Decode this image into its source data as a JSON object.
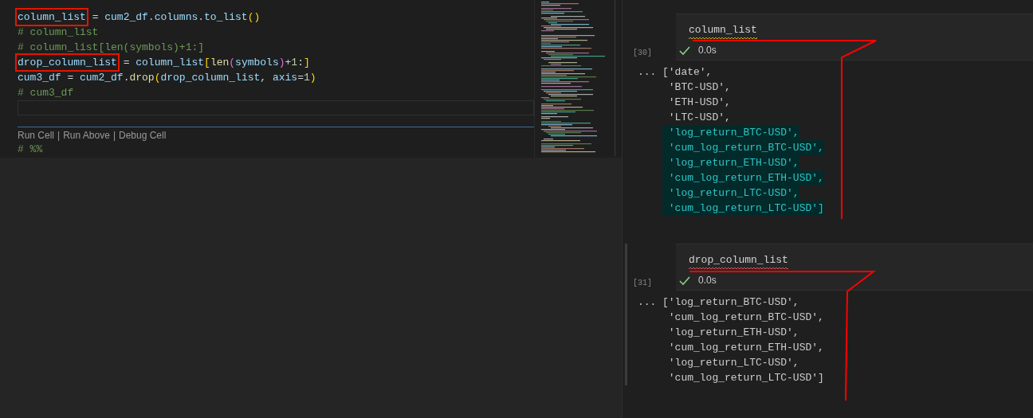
{
  "editor": {
    "lines": [
      [
        {
          "text": "column_list",
          "kind": "var",
          "boxed": true
        },
        {
          "text": " = ",
          "kind": "plain",
          "boxed": false
        },
        {
          "text": "cum2_df.columns.to_list",
          "kind": "var",
          "boxed": false
        },
        {
          "text": "()",
          "kind": "paren",
          "boxed": false
        }
      ],
      [
        {
          "text": "# column_list",
          "kind": "comment",
          "boxed": false
        }
      ],
      [
        {
          "text": "# column_list[len(symbols)+1:]",
          "kind": "comment",
          "boxed": false
        }
      ],
      [
        {
          "text": "drop_column_list",
          "kind": "var",
          "boxed": true
        },
        {
          "text": " = ",
          "kind": "plain",
          "boxed": false
        },
        {
          "text": "column_list",
          "kind": "var",
          "boxed": false
        },
        {
          "text": "[",
          "kind": "paren",
          "boxed": false
        },
        {
          "text": "len",
          "kind": "func",
          "boxed": false
        },
        {
          "text": "(",
          "kind": "paren2",
          "boxed": false
        },
        {
          "text": "symbols",
          "kind": "var",
          "boxed": false
        },
        {
          "text": ")",
          "kind": "paren2",
          "boxed": false
        },
        {
          "text": "+",
          "kind": "plain",
          "boxed": false
        },
        {
          "text": "1",
          "kind": "num",
          "boxed": false
        },
        {
          "text": ":",
          "kind": "plain",
          "boxed": false
        },
        {
          "text": "]",
          "kind": "paren",
          "boxed": false
        }
      ],
      [
        {
          "text": "cum3_df",
          "kind": "var",
          "boxed": false
        },
        {
          "text": " = ",
          "kind": "plain",
          "boxed": false
        },
        {
          "text": "cum2_df",
          "kind": "var",
          "boxed": false
        },
        {
          "text": ".",
          "kind": "plain",
          "boxed": false
        },
        {
          "text": "drop",
          "kind": "func",
          "boxed": false
        },
        {
          "text": "(",
          "kind": "paren",
          "boxed": false
        },
        {
          "text": "drop_column_list",
          "kind": "var",
          "boxed": false
        },
        {
          "text": ", ",
          "kind": "plain",
          "boxed": false
        },
        {
          "text": "axis",
          "kind": "var",
          "boxed": false
        },
        {
          "text": "=",
          "kind": "plain",
          "boxed": false
        },
        {
          "text": "1",
          "kind": "num",
          "boxed": false
        },
        {
          "text": ")",
          "kind": "paren",
          "boxed": false
        }
      ],
      [
        {
          "text": "# cum3_df",
          "kind": "comment",
          "boxed": false
        }
      ]
    ],
    "codelens": {
      "actions": [
        "Run Cell",
        "Run Above",
        "Debug Cell"
      ],
      "separator": "|"
    },
    "next_cell_line": "# %%"
  },
  "notebook": {
    "cells": [
      {
        "execution_count": "[30]",
        "code": "column_list",
        "color": "#cca700",
        "focused": false,
        "success": true,
        "duration": "0.0s",
        "output_prompt": "...",
        "output": [
          {
            "text": "['date',",
            "highlighted": false
          },
          {
            "text": " 'BTC-USD',",
            "highlighted": false
          },
          {
            "text": " 'ETH-USD',",
            "highlighted": false
          },
          {
            "text": " 'LTC-USD',",
            "highlighted": false
          },
          {
            "text": " 'log_return_BTC-USD',",
            "highlighted": true
          },
          {
            "text": " 'cum_log_return_BTC-USD',",
            "highlighted": true
          },
          {
            "text": " 'log_return_ETH-USD',",
            "highlighted": true
          },
          {
            "text": " 'cum_log_return_ETH-USD',",
            "highlighted": true
          },
          {
            "text": " 'log_return_LTC-USD',",
            "highlighted": true
          },
          {
            "text": " 'cum_log_return_LTC-USD']",
            "highlighted": true
          }
        ]
      },
      {
        "execution_count": "[31]",
        "code": "drop_column_list",
        "color": "#f14c4c",
        "focused": true,
        "success": true,
        "duration": "0.0s",
        "output_prompt": "...",
        "output": [
          {
            "text": "['log_return_BTC-USD',",
            "highlighted": false
          },
          {
            "text": " 'cum_log_return_BTC-USD',",
            "highlighted": false
          },
          {
            "text": " 'log_return_ETH-USD',",
            "highlighted": false
          },
          {
            "text": " 'cum_log_return_ETH-USD',",
            "highlighted": false
          },
          {
            "text": " 'log_return_LTC-USD',",
            "highlighted": false
          },
          {
            "text": " 'cum_log_return_LTC-USD']",
            "highlighted": false
          }
        ]
      }
    ]
  }
}
